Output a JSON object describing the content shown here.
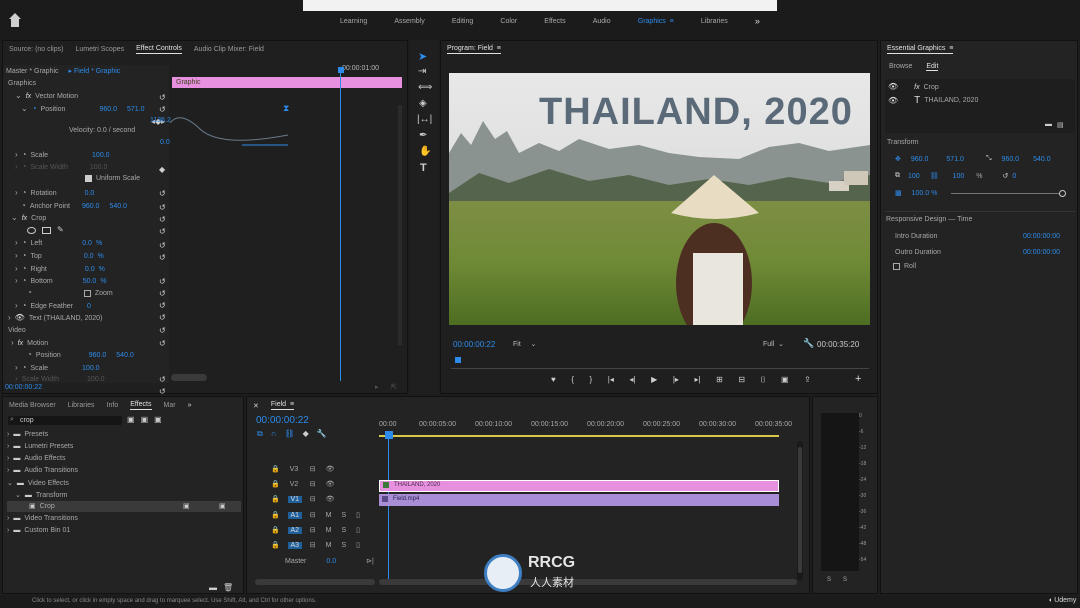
{
  "workspaces": {
    "tabs": [
      "Learning",
      "Assembly",
      "Editing",
      "Color",
      "Effects",
      "Audio",
      "Graphics",
      "Libraries"
    ],
    "active": "Graphics",
    "more": "»"
  },
  "source_panel": {
    "tabs": [
      "Source: (no clips)",
      "Lumetri Scopes",
      "Effect Controls",
      "Audio Clip Mixer: Field"
    ],
    "active_tab": "Effect Controls",
    "master_label": "Master * Graphic",
    "clip_label": "Field * Graphic",
    "timecode_top": "00:00:01:00",
    "clip_bar_label": "Graphic",
    "section_graphics": "Graphics",
    "vector_motion": "Vector Motion",
    "position": {
      "label": "Position",
      "x": "960.0",
      "y": "571.0"
    },
    "velocity": "Velocity: 0.0 / second",
    "graph_top": "1136.2",
    "graph_zero": "0.0",
    "scale": {
      "label": "Scale",
      "value": "100.0"
    },
    "scale_width": {
      "label": "Scale Width",
      "value": "100.0"
    },
    "uniform_scale": "Uniform Scale",
    "rotation": {
      "label": "Rotation",
      "value": "0.0"
    },
    "anchor_point": {
      "label": "Anchor Point",
      "x": "960.0",
      "y": "540.0"
    },
    "crop_section": "Crop",
    "left": {
      "label": "Left",
      "value": "0.0",
      "unit": "%"
    },
    "top": {
      "label": "Top",
      "value": "0.0",
      "unit": "%"
    },
    "right": {
      "label": "Right",
      "value": "0.0",
      "unit": "%"
    },
    "bottom": {
      "label": "Bottom",
      "value": "50.0",
      "unit": "%"
    },
    "zoom": "Zoom",
    "edge_feather": {
      "label": "Edge Feather",
      "value": "0"
    },
    "text_layer": "Text (THAILAND, 2020)",
    "section_video": "Video",
    "motion": "Motion",
    "motion_position": {
      "label": "Position",
      "x": "960.0",
      "y": "540.0"
    },
    "motion_scale": {
      "label": "Scale",
      "value": "100.0"
    },
    "motion_scale_width": {
      "label": "Scale Width",
      "value": "100.0"
    },
    "timecode_bottom": "00:00:00:22"
  },
  "program": {
    "title": "Program: Field",
    "overlay_text": "THAILAND, 2020",
    "timecode": "00:00:00:22",
    "fit": "Fit",
    "quality": "Full",
    "duration": "00:00:35:20"
  },
  "tools": [
    "selection",
    "track-select",
    "ripple",
    "razor",
    "slip",
    "pen",
    "hand",
    "type"
  ],
  "project_panel": {
    "tabs": [
      "Media Browser",
      "Libraries",
      "Info",
      "Effects",
      "Mar"
    ],
    "active_tab": "Effects",
    "search_value": "crop",
    "tree": [
      {
        "label": "Presets",
        "indent": 0
      },
      {
        "label": "Lumetri Presets",
        "indent": 0
      },
      {
        "label": "Audio Effects",
        "indent": 0
      },
      {
        "label": "Audio Transitions",
        "indent": 0
      },
      {
        "label": "Video Effects",
        "indent": 0
      },
      {
        "label": "Transform",
        "indent": 1
      },
      {
        "label": "Crop",
        "indent": 2
      },
      {
        "label": "Video Transitions",
        "indent": 0
      },
      {
        "label": "Custom Bin 01",
        "indent": 0
      }
    ]
  },
  "timeline": {
    "title": "Field",
    "timecode": "00:00:00:22",
    "ruler": [
      "00:00",
      "00:00:05:00",
      "00:00:10:00",
      "00:00:15:00",
      "00:00:20:00",
      "00:00:25:00",
      "00:00:30:00",
      "00:00:35:00"
    ],
    "tracks": [
      "V3",
      "V2",
      "V1",
      "A1",
      "A2",
      "A3"
    ],
    "master": "Master",
    "master_value": "0.0",
    "clip_v2": "THAILAND, 2020",
    "clip_v1": "Field.mp4"
  },
  "meters": {
    "scale": [
      "0",
      "-6",
      "-12",
      "-18",
      "-24",
      "-30",
      "-36",
      "-42",
      "-48",
      "-54"
    ],
    "solo": [
      "S",
      "S"
    ]
  },
  "essential_graphics": {
    "title": "Essential Graphics",
    "tabs": [
      "Browse",
      "Edit"
    ],
    "active_tab": "Edit",
    "layers": [
      "Crop",
      "THAILAND, 2020"
    ],
    "transform_label": "Transform",
    "pos_x": "960.0",
    "pos_y": "571.0",
    "anchor_x": "960.0",
    "anchor_y": "540.0",
    "scale": "100",
    "scale2": "100",
    "unit": "%",
    "rotation": "0",
    "opacity": "100.0 %",
    "responsive": "Responsive Design — Time",
    "intro_label": "Intro Duration",
    "intro_value": "00:00:00:00",
    "outro_label": "Outro Duration",
    "outro_value": "00:00:00:00",
    "roll": "Roll"
  },
  "status_bar": "Click to select, or click in empty space and drag to marquee select. Use Shift, Alt, and Ctrl for other options.",
  "watermark": {
    "brand": "RRCG",
    "sub": "人人素材"
  },
  "udemy": "Udemy"
}
